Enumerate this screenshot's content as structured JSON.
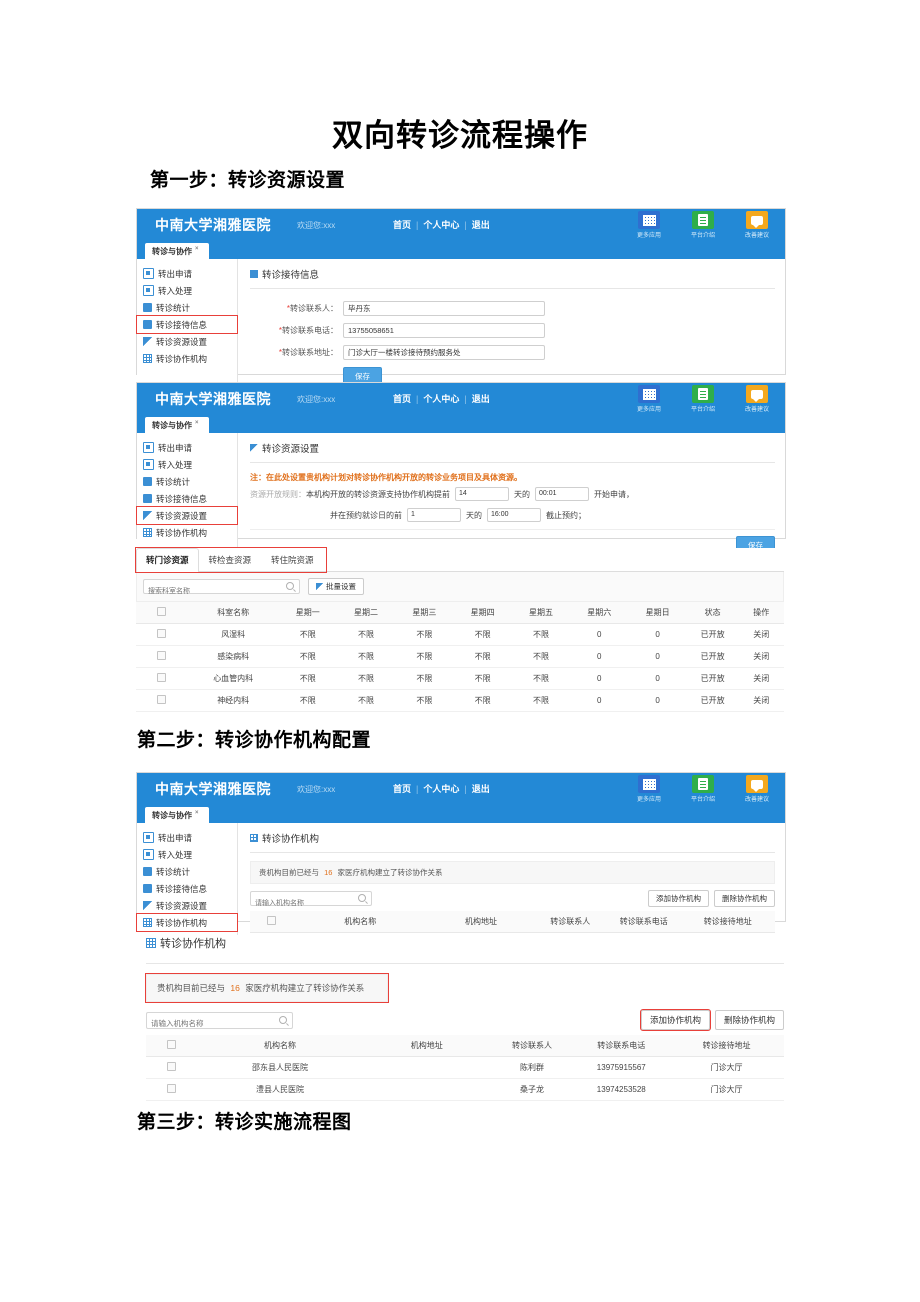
{
  "document": {
    "title": "双向转诊流程操作",
    "step1": "第一步：转诊资源设置",
    "step2": "第二步：转诊协作机构配置",
    "step3": "第三步：转诊实施流程图"
  },
  "header": {
    "brand": "中南大学湘雅医院",
    "welcome": "欢迎您:xxx",
    "nav_home": "首页",
    "nav_profile": "个人中心",
    "nav_logout": "退出",
    "separator": "|",
    "icons": [
      {
        "name": "更多应用",
        "color": "#2f6fd0"
      },
      {
        "name": "平台介绍",
        "color": "#2fae4a"
      },
      {
        "name": "改善建议",
        "color": "#f4a81d"
      }
    ],
    "window_tab": "转诊与协作",
    "window_tab_close": "×"
  },
  "sidebar": {
    "items": [
      {
        "label": "转出申请"
      },
      {
        "label": "转入处理"
      },
      {
        "label": "转诊统计"
      },
      {
        "label": "转诊接待信息"
      },
      {
        "label": "转诊资源设置"
      },
      {
        "label": "转诊协作机构"
      }
    ]
  },
  "panel_reception": {
    "title": "转诊接待信息",
    "fields": [
      {
        "label": "转诊联系人：",
        "value": "毕丹东"
      },
      {
        "label": "转诊联系电话：",
        "value": "13755058651"
      },
      {
        "label": "转诊联系地址：",
        "value": "门诊大厅一楼转诊接待预约服务处"
      }
    ],
    "save_label": "保存"
  },
  "panel_resource": {
    "title": "转诊资源设置",
    "note": "注：在此处设置贵机构计划对转诊协作机构开放的转诊业务项目及具体资源。",
    "rule_label": "资源开放规则：",
    "rule_text_1": "本机构开放的转诊资源支持协作机构提前",
    "days_value": "14",
    "unit_day": "天的",
    "time_start": "00:01",
    "rule_text_2": "开始申请，",
    "rule_text_3": "并在预约就诊日的前",
    "days_value_2": "1",
    "unit_day_2": "天的",
    "time_end": "16:00",
    "rule_text_4": "截止预约；",
    "save_label": "保存"
  },
  "resource_tabs": {
    "tabs": [
      {
        "label": "转门诊资源",
        "active": true
      },
      {
        "label": "转检查资源",
        "active": false
      },
      {
        "label": "转住院资源",
        "active": false
      }
    ],
    "search_placeholder": "搜索科室名称",
    "batch_button": "批量设置",
    "columns": [
      "",
      "科室名称",
      "星期一",
      "星期二",
      "星期三",
      "星期四",
      "星期五",
      "星期六",
      "星期日",
      "状态",
      "操作"
    ],
    "rows": [
      {
        "dept": "风湿科",
        "mon": "不限",
        "tue": "不限",
        "wed": "不限",
        "thu": "不限",
        "fri": "不限",
        "sat": "0",
        "sun": "0",
        "status": "已开放",
        "action": "关闭"
      },
      {
        "dept": "感染病科",
        "mon": "不限",
        "tue": "不限",
        "wed": "不限",
        "thu": "不限",
        "fri": "不限",
        "sat": "0",
        "sun": "0",
        "status": "已开放",
        "action": "关闭"
      },
      {
        "dept": "心血管内科",
        "mon": "不限",
        "tue": "不限",
        "wed": "不限",
        "thu": "不限",
        "fri": "不限",
        "sat": "0",
        "sun": "0",
        "status": "已开放",
        "action": "关闭"
      },
      {
        "dept": "神经内科",
        "mon": "不限",
        "tue": "不限",
        "wed": "不限",
        "thu": "不限",
        "fri": "不限",
        "sat": "0",
        "sun": "0",
        "status": "已开放",
        "action": "关闭"
      }
    ]
  },
  "panel_partner": {
    "title": "转诊协作机构",
    "info_prefix": "贵机构目前已经与",
    "info_count": "16",
    "info_suffix": "家医疗机构建立了转诊协作关系",
    "search_placeholder": "请输入机构名称",
    "add_button": "添加协作机构",
    "delete_button": "删除协作机构",
    "columns": [
      "",
      "机构名称",
      "机构地址",
      "转诊联系人",
      "转诊联系电话",
      "转诊接待地址"
    ],
    "rows": [
      {
        "org": "邵东县人民医院",
        "addr": "",
        "contact": "陈利群",
        "phone": "13975915567",
        "reception": "门诊大厅"
      },
      {
        "org": "澧县人民医院",
        "addr": "",
        "contact": "桑子龙",
        "phone": "13974253528",
        "reception": "门诊大厅"
      }
    ]
  },
  "colors": {
    "header_blue": "#2389d6",
    "accent_blue": "#3b8fd4",
    "highlight_red": "#e8403a",
    "note_orange": "#e0701c",
    "status_green": "#4caf50"
  }
}
